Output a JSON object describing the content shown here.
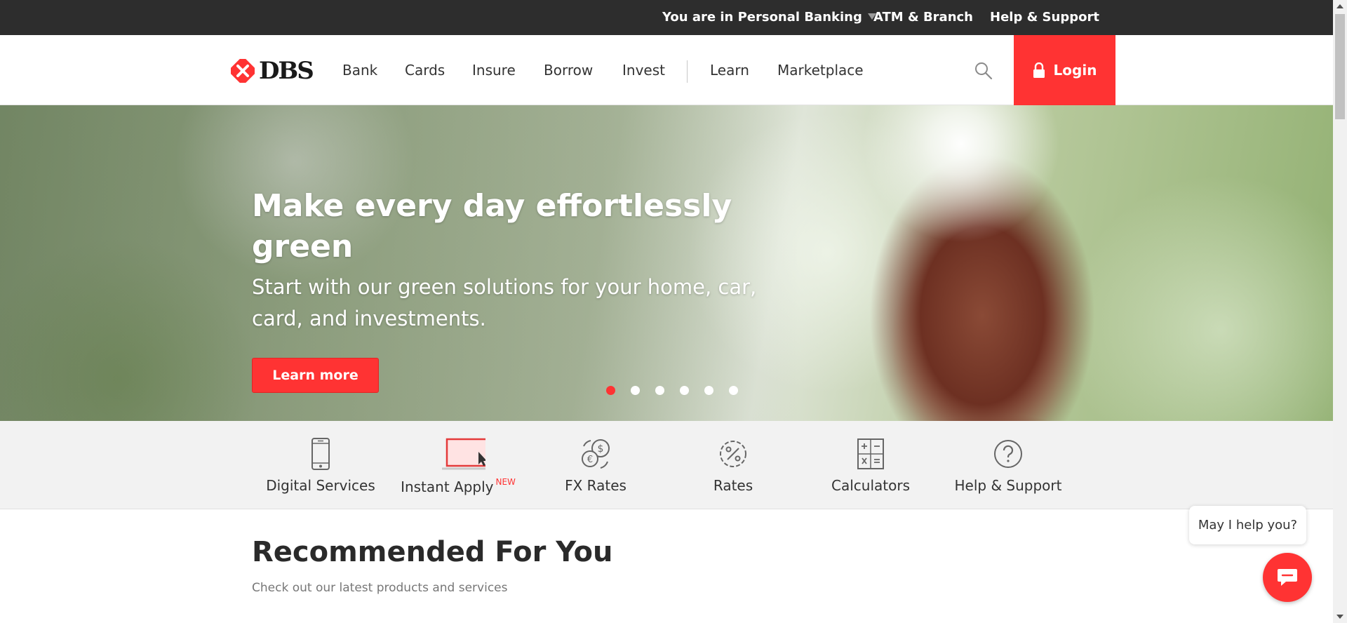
{
  "utility_bar": {
    "segment_label": "You are in Personal Banking",
    "atm_branch": "ATM & Branch",
    "help_support": "Help & Support"
  },
  "header": {
    "logo_text": "DBS",
    "nav": [
      "Bank",
      "Cards",
      "Insure",
      "Borrow",
      "Invest",
      "Learn",
      "Marketplace"
    ],
    "login_label": "Login",
    "search_icon": "search-icon",
    "lock_icon": "lock-icon"
  },
  "hero": {
    "title": "Make every day effortlessly green",
    "subtitle": "Start with our green solutions for your home, car, card, and investments.",
    "cta_label": "Learn more",
    "slide_count": 6,
    "active_slide": 1
  },
  "quick_links": [
    {
      "label": "Digital Services",
      "icon": "mobile-phone-icon"
    },
    {
      "label": "Instant Apply",
      "badge": "NEW",
      "icon": "laptop-cursor-icon"
    },
    {
      "label": "FX Rates",
      "icon": "currency-exchange-icon"
    },
    {
      "label": "Rates",
      "icon": "percent-icon"
    },
    {
      "label": "Calculators",
      "icon": "calculator-icon"
    },
    {
      "label": "Help & Support",
      "icon": "question-icon"
    }
  ],
  "recommended": {
    "title": "Recommended For You",
    "subtitle": "Check out our latest products and services"
  },
  "chat": {
    "prompt": "May I help you?",
    "icon": "chat-icon"
  },
  "colors": {
    "brand_red": "#ff3333",
    "utility_bg": "#2d2d2d",
    "quick_links_bg": "#f2f2f2"
  }
}
